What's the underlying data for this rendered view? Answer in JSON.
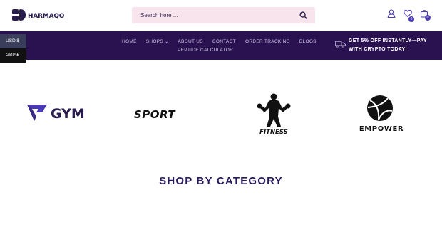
{
  "logo": {
    "text": "HARMAQO"
  },
  "search": {
    "placeholder": "Search here ..."
  },
  "header": {
    "wishlist_count": "0",
    "cart_count": "0"
  },
  "nav": {
    "items": [
      "HOME",
      "SHOPS",
      "ABOUT US",
      "CONTACT",
      "ORDER TRACKING",
      "BLOGS"
    ],
    "row2": [
      "PEPTIDE CALCULATOR"
    ]
  },
  "promo": {
    "line1": "GET 5% OFF INSTANTLY—PAY",
    "line2": "WITH CRYPTO TODAY!"
  },
  "currency": {
    "usd": "USD $",
    "gbp": "GBP £"
  },
  "brands": {
    "gym": "GYM",
    "sport": "SPORT",
    "fitness": "FITNESS",
    "empower": "EMPOWER"
  },
  "section": {
    "title": "SHOP BY CATEGORY"
  },
  "colors": {
    "nav_bg": "#2a1251",
    "title": "#2a1a5e",
    "search_bg": "#f7e4ec",
    "badge": "#4a3ab8"
  }
}
